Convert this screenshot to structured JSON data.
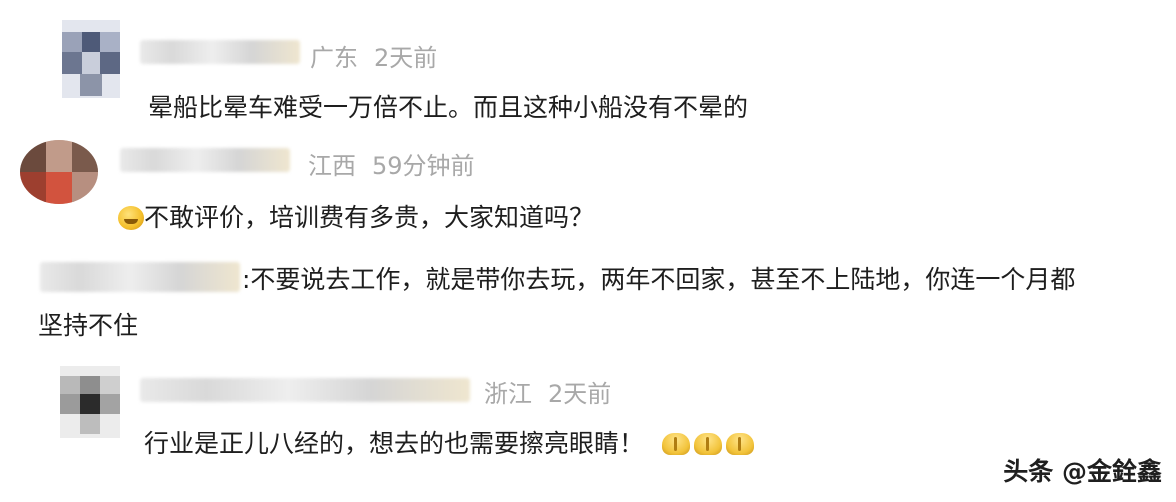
{
  "comments": [
    {
      "location": "广东",
      "time": "2天前",
      "text": "晕船比晕车难受一万倍不止。而且这种小船没有不晕的"
    },
    {
      "location": "江西",
      "time": "59分钟前",
      "text": "不敢评价，培训费有多贵，大家知道吗？",
      "leading_emoji": "grimace-emoji"
    },
    {
      "text_line1": ":不要说去工作，就是带你去玩，两年不回家，甚至不上陆地，你连一个月都",
      "text_line2": "坚持不住"
    },
    {
      "location": "浙江",
      "time": "2天前",
      "text": "行业是正儿八经的，想去的也需要擦亮眼睛！",
      "trailing_emoji": [
        "clap-emoji",
        "clap-emoji",
        "clap-emoji"
      ]
    }
  ],
  "watermark": "头条 @金銓鑫"
}
